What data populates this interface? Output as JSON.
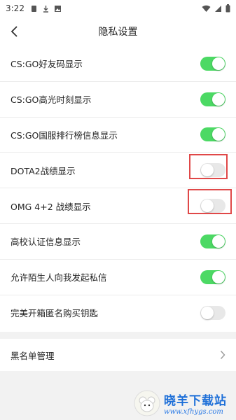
{
  "status_bar": {
    "time": "3:22",
    "icons_left": [
      "sim-icon",
      "download-icon",
      "gallery-icon"
    ],
    "icons_right": [
      "wifi-icon",
      "signal-icon",
      "battery-icon"
    ]
  },
  "nav": {
    "title": "隐私设置",
    "back_icon": "chevron-left-icon"
  },
  "settings": [
    {
      "label": "CS:GO好友码显示",
      "enabled": true
    },
    {
      "label": "CS:GO高光时刻显示",
      "enabled": true
    },
    {
      "label": "CS:GO国服排行榜信息显示",
      "enabled": true
    },
    {
      "label": "DOTA2战绩显示",
      "enabled": false
    },
    {
      "label": "OMG 4+2 战绩显示",
      "enabled": false
    },
    {
      "label": "高校认证信息显示",
      "enabled": true
    },
    {
      "label": "允许陌生人向我发起私信",
      "enabled": true
    },
    {
      "label": "完美开箱匿名购买钥匙",
      "enabled": false
    }
  ],
  "blacklist": {
    "label": "黑名单管理",
    "icon": "chevron-right-icon"
  },
  "watermark": {
    "title": "晓羊下载站",
    "url": "www.xfhygs.com"
  },
  "colors": {
    "toggle_on": "#4cd964",
    "toggle_off": "#e8e8e8",
    "highlight": "#e04848",
    "background_gray": "#f2f2f2"
  }
}
